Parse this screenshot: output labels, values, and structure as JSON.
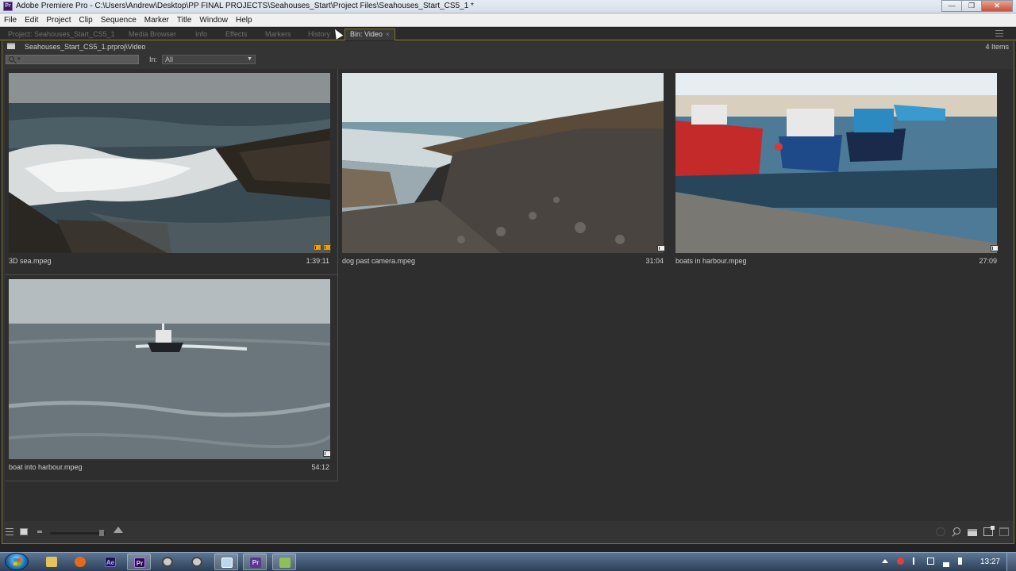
{
  "window": {
    "title": "Adobe Premiere Pro - C:\\Users\\Andrew\\Desktop\\PP FINAL PROJECTS\\Seahouses_Start\\Project Files\\Seahouses_Start_CS5_1 *",
    "app_icon": "premiere-pro-icon",
    "buttons": {
      "minimize": "—",
      "maximize": "❐",
      "close": "✕"
    }
  },
  "menu": [
    "File",
    "Edit",
    "Project",
    "Clip",
    "Sequence",
    "Marker",
    "Title",
    "Window",
    "Help"
  ],
  "tabs": [
    {
      "label": "Project: Seahouses_Start_CS5_1",
      "active": false
    },
    {
      "label": "Media Browser",
      "active": false
    },
    {
      "label": "Info",
      "active": false
    },
    {
      "label": "Effects",
      "active": false
    },
    {
      "label": "Markers",
      "active": false
    },
    {
      "label": "History",
      "active": false
    },
    {
      "label": "Bin: Video",
      "active": true,
      "close": "×"
    }
  ],
  "bin": {
    "path": "Seahouses_Start_CS5_1.prproj\\Video",
    "item_count": "4 Items",
    "search": {
      "value": "",
      "caret": "▾"
    },
    "in_label": "In:",
    "in_value": "All"
  },
  "clips": [
    {
      "name": "3D sea.mpeg",
      "duration": "1:39:11",
      "type": "video-audio"
    },
    {
      "name": "dog past camera.mpeg",
      "duration": "31:04",
      "type": "video"
    },
    {
      "name": "boats in harbour.mpeg",
      "duration": "27:09",
      "type": "video"
    },
    {
      "name": "boat into harbour.mpeg",
      "duration": "54:12",
      "type": "video"
    }
  ],
  "taskbar": {
    "apps": [
      {
        "icon": "explorer-icon",
        "glyph": "",
        "color": "#e6c35a"
      },
      {
        "icon": "firefox-icon",
        "glyph": "",
        "color": "#e66a1e"
      },
      {
        "icon": "after-effects-icon",
        "glyph": "Ae",
        "color": "#1a1a4a"
      },
      {
        "icon": "premiere-pro-icon",
        "glyph": "Pr",
        "color": "#2a0f4a"
      },
      {
        "icon": "chrome-icon-1",
        "glyph": "",
        "color": "#cccccc"
      },
      {
        "icon": "chrome-icon-2",
        "glyph": "",
        "color": "#cccccc"
      },
      {
        "icon": "window-icon",
        "glyph": "",
        "color": "#bcd6ee"
      },
      {
        "icon": "premiere-pro-icon-2",
        "glyph": "Pr",
        "color": "#5a3a88"
      },
      {
        "icon": "toolbox-icon",
        "glyph": "",
        "color": "#8fbf5a"
      }
    ],
    "clock": "13:27"
  }
}
